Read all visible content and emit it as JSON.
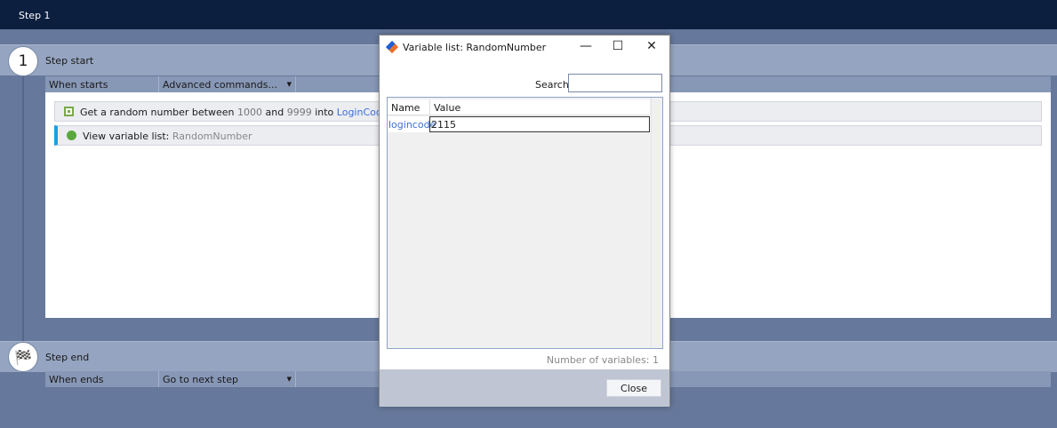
{
  "window": {
    "title": "Step 1"
  },
  "step_start": {
    "number": "1",
    "label": "Step start",
    "trigger_label": "When starts",
    "trigger_select": "Advanced commands..."
  },
  "commands": [
    {
      "parts": {
        "a": "Get a random number between",
        "min": "1000",
        "and": "and",
        "max": "9999",
        "into": "into",
        "var": "LoginCode"
      }
    },
    {
      "parts": {
        "a": "View variable list:",
        "arg": "RandomNumber"
      }
    }
  ],
  "step_end": {
    "label": "Step end",
    "trigger_label": "When ends",
    "trigger_select": "Go to next step"
  },
  "dialog": {
    "title": "Variable list: RandomNumber",
    "search_label": "Search:",
    "search_value": "",
    "columns": [
      "Name",
      "Value"
    ],
    "rows": [
      {
        "name": "logincode",
        "value": "2115"
      }
    ],
    "count_text": "Number of variables: 1",
    "close_label": "Close"
  }
}
